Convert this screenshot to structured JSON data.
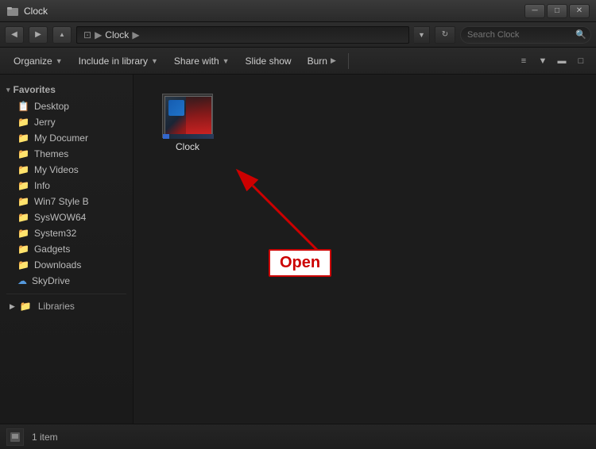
{
  "titlebar": {
    "title": "Clock",
    "controls": {
      "minimize": "─",
      "maximize": "□",
      "close": "✕"
    }
  },
  "addressbar": {
    "back_label": "◀",
    "forward_label": "▶",
    "path_root": "Clock",
    "path_current": "Clock",
    "dropdown_label": "▼",
    "search_placeholder": "Search Clock",
    "search_icon": "🔍"
  },
  "toolbar": {
    "organize_label": "Organize",
    "include_in_library_label": "Include in library",
    "share_with_label": "Share with",
    "slide_show_label": "Slide show",
    "burn_label": "Burn",
    "dropdown_arrow": "▼",
    "play_arrow": "▶",
    "view_icons": [
      "≡",
      "▬",
      "□"
    ]
  },
  "sidebar": {
    "favorites_label": "Favorites",
    "favorites_arrow": "▾",
    "items": [
      {
        "id": "desktop",
        "label": "Desktop",
        "icon": "📋"
      },
      {
        "id": "jerry",
        "label": "Jerry",
        "icon": "📁"
      },
      {
        "id": "my-documents",
        "label": "My Documer",
        "icon": "📁"
      },
      {
        "id": "themes",
        "label": "Themes",
        "icon": "📁"
      },
      {
        "id": "my-videos",
        "label": "My Videos",
        "icon": "📁"
      },
      {
        "id": "info",
        "label": "Info",
        "icon": "📁"
      },
      {
        "id": "win7-style",
        "label": "Win7 Style B‌",
        "icon": "📁"
      },
      {
        "id": "syswow64",
        "label": "SysWOW64",
        "icon": "📁"
      },
      {
        "id": "system32",
        "label": "System32",
        "icon": "📁"
      },
      {
        "id": "gadgets",
        "label": "Gadgets",
        "icon": "📁"
      },
      {
        "id": "downloads",
        "label": "Downloads",
        "icon": "📁"
      },
      {
        "id": "skydrive",
        "label": "SkyDrive",
        "icon": "☁"
      }
    ],
    "libraries_label": "Libraries",
    "libraries_icon": "📁"
  },
  "file_view": {
    "file_name": "Clock",
    "open_label": "Open"
  },
  "statusbar": {
    "item_count": "1 item"
  }
}
